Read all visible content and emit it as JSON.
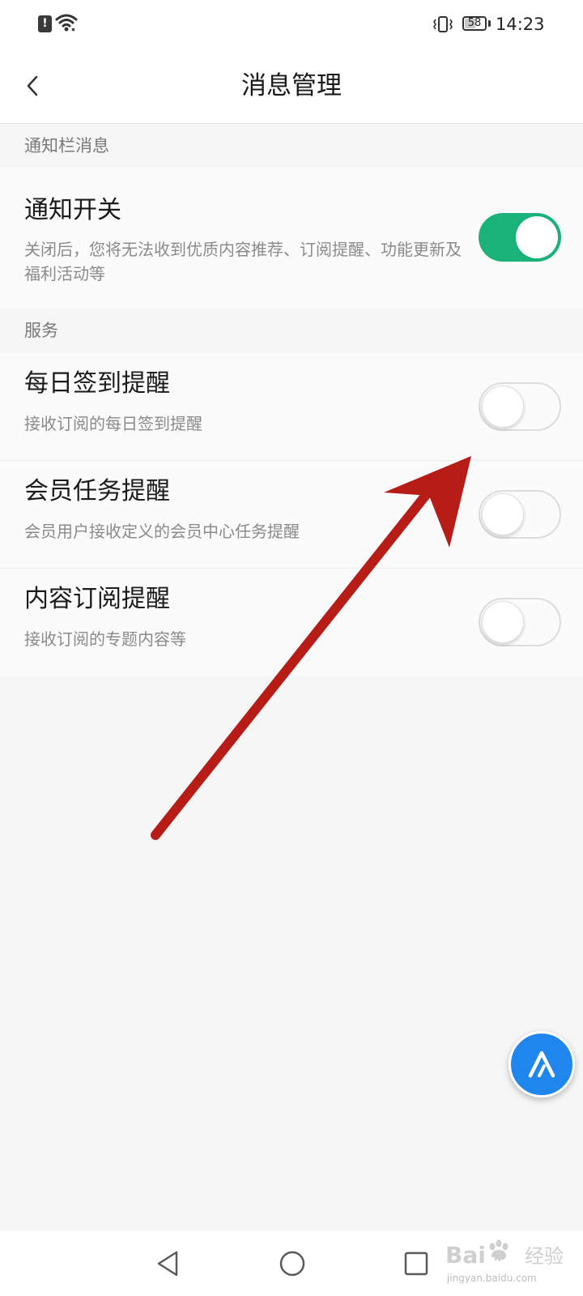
{
  "status_bar": {
    "time": "14:23",
    "battery_level": "58",
    "battery_fraction": 0.58,
    "icons": [
      "alert-icon",
      "wifi-icon",
      "vibrate-icon",
      "battery-icon"
    ]
  },
  "header": {
    "title": "消息管理",
    "back_icon": "chevron-left-icon"
  },
  "sections": {
    "notification_bar": {
      "label": "通知栏消息",
      "notify_switch": {
        "title": "通知开关",
        "description": "关闭后，您将无法收到优质内容推荐、订阅提醒、功能更新及福利活动等",
        "enabled": true
      }
    },
    "services": {
      "label": "服务",
      "items": [
        {
          "title": "每日签到提醒",
          "description": "接收订阅的每日签到提醒",
          "enabled": false
        },
        {
          "title": "会员任务提醒",
          "description": "会员用户接收定义的会员中心任务提醒",
          "enabled": false
        },
        {
          "title": "内容订阅提醒",
          "description": "接收订阅的专题内容等",
          "enabled": false
        }
      ]
    }
  },
  "floating_button": {
    "icon": "assistant-logo-icon"
  },
  "nav_bar": {
    "icons": [
      "nav-back-icon",
      "nav-home-icon",
      "nav-recent-apps-icon"
    ]
  },
  "watermark": {
    "url": "jingyan.baidu.com"
  },
  "colors": {
    "toggle_on": "#1bb27a",
    "annotation_arrow": "#b71c17",
    "floating_button": "#1f86ee"
  }
}
